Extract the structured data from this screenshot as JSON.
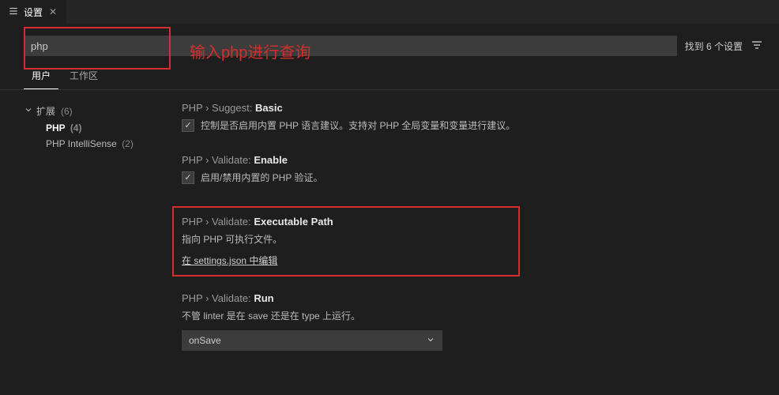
{
  "tabbar": {
    "title": "设置"
  },
  "search": {
    "value": "php",
    "found": "找到 6 个设置"
  },
  "annotation": {
    "text": "输入php进行查询"
  },
  "tabs2": [
    {
      "label": "用户",
      "active": true
    },
    {
      "label": "工作区",
      "active": false
    }
  ],
  "tree": {
    "root": {
      "label": "扩展",
      "count": "(6)"
    },
    "children": [
      {
        "label": "PHP",
        "count": "(4)",
        "selected": true
      },
      {
        "label": "PHP IntelliSense",
        "count": "(2)",
        "selected": false
      }
    ]
  },
  "settings": [
    {
      "crumb": "PHP › Suggest:",
      "name": "Basic",
      "desc": "控制是否启用内置 PHP 语言建议。支持对 PHP 全局变量和变量进行建议。",
      "checkbox": true,
      "checked": true
    },
    {
      "crumb": "PHP › Validate:",
      "name": "Enable",
      "desc": "启用/禁用内置的 PHP 验证。",
      "checkbox": true,
      "checked": true
    },
    {
      "crumb": "PHP › Validate:",
      "name": "Executable Path",
      "desc": "指向 PHP 可执行文件。",
      "link": "在 settings.json 中编辑",
      "highlighted": true
    },
    {
      "crumb": "PHP › Validate:",
      "name": "Run",
      "desc": "不管 linter 是在 save 还是在 type 上运行。",
      "select": "onSave"
    }
  ]
}
